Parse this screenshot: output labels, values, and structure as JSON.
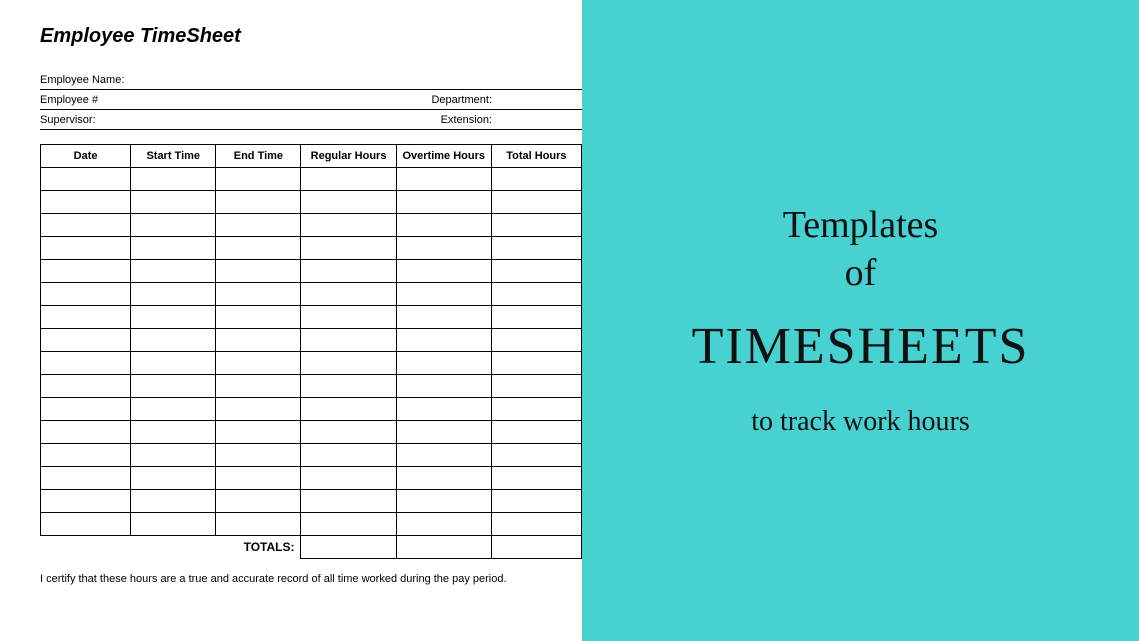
{
  "doc": {
    "title": "Employee TimeSheet",
    "fields": {
      "employee_name": "Employee Name:",
      "employee_no": "Employee #",
      "department": "Department:",
      "supervisor": "Supervisor:",
      "extension": "Extension:"
    },
    "columns": [
      "Date",
      "Start Time",
      "End Time",
      "Regular Hours",
      "Overtime Hours",
      "Total Hours"
    ],
    "row_count": 16,
    "totals_label": "TOTALS:",
    "cert": "I certify that these hours are a true and accurate record of all time worked during the pay period."
  },
  "banner": {
    "line1": "Templates",
    "line2": "of",
    "line3": "TIMESHEETS",
    "line4": "to track work hours"
  },
  "colors": {
    "banner_bg": "#47d1d1"
  }
}
